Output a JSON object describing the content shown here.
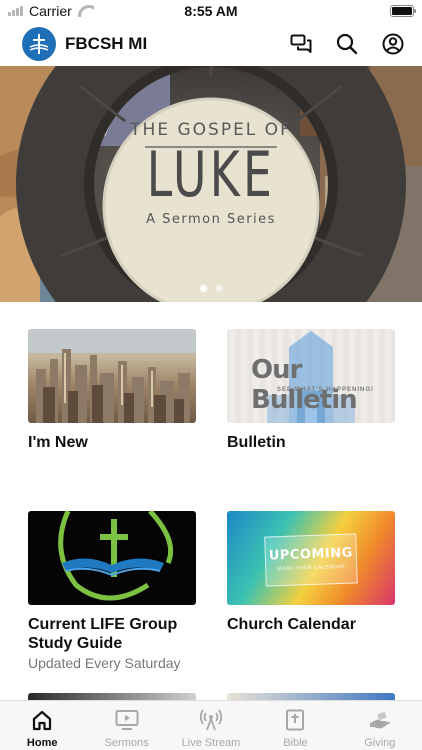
{
  "status_bar": {
    "carrier": "Carrier",
    "time": "8:55 AM"
  },
  "header": {
    "title": "FBCSH MI"
  },
  "hero": {
    "kicker": "THE GOSPEL OF",
    "title": "LUKE",
    "subtitle": "A Sermon Series",
    "slide_count": 2,
    "active_slide": 1
  },
  "tiles": [
    {
      "label": "I'm New",
      "subtitle": ""
    },
    {
      "label": "Bulletin",
      "subtitle": "",
      "image_text": "Our Bulletin",
      "image_subtext": "SEE WHAT'S HAPPENING!"
    },
    {
      "label": "Current LIFE Group Study Guide",
      "subtitle": "Updated Every Saturday"
    },
    {
      "label": "Church Calendar",
      "subtitle": "",
      "image_text": "UPCOMING",
      "image_subtext": "MARK YOUR CALENDAR"
    }
  ],
  "tab_bar": {
    "active": "Home",
    "items": [
      {
        "label": "Home",
        "icon": "home-icon"
      },
      {
        "label": "Sermons",
        "icon": "tv-play-icon"
      },
      {
        "label": "Live Stream",
        "icon": "broadcast-icon"
      },
      {
        "label": "Bible",
        "icon": "bible-icon"
      },
      {
        "label": "Giving",
        "icon": "giving-hand-icon"
      }
    ]
  },
  "colors": {
    "brand": "#1f6fb8",
    "active_tab": "#111111",
    "inactive_tab": "#a8a8a8"
  }
}
